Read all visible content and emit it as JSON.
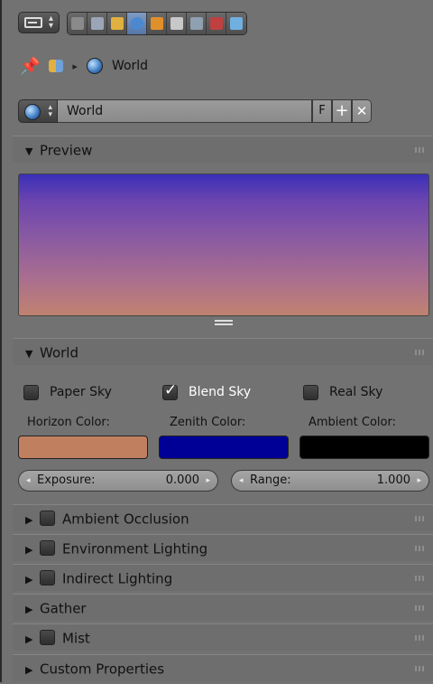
{
  "toolbar": {
    "tabs": [
      {
        "icon": "render-icon",
        "color": "#8a8a8a",
        "active": false
      },
      {
        "icon": "render-layers-icon",
        "color": "#9aa6b8",
        "active": false
      },
      {
        "icon": "scene-icon",
        "color": "#e0b040",
        "active": false
      },
      {
        "icon": "world-icon",
        "color": "#4b88d0",
        "active": true
      },
      {
        "icon": "object-icon",
        "color": "#e0902a",
        "active": false
      },
      {
        "icon": "constraints-icon",
        "color": "#c8c8c8",
        "active": false
      },
      {
        "icon": "modifiers-icon",
        "color": "#8fa0b0",
        "active": false
      },
      {
        "icon": "texture-icon",
        "color": "#c04040",
        "active": false
      },
      {
        "icon": "particles-icon",
        "color": "#70b0e0",
        "active": false
      }
    ]
  },
  "breadcrumb": {
    "label": "World"
  },
  "datablock": {
    "name": "World",
    "fake_user": "F",
    "add": "+",
    "remove": "✕"
  },
  "panels": {
    "preview": "Preview",
    "world": "World",
    "ambient_occlusion": "Ambient Occlusion",
    "environment_lighting": "Environment Lighting",
    "indirect_lighting": "Indirect Lighting",
    "gather": "Gather",
    "mist": "Mist",
    "custom_properties": "Custom Properties"
  },
  "world": {
    "paper_sky": {
      "label": "Paper Sky",
      "checked": false
    },
    "blend_sky": {
      "label": "Blend Sky",
      "checked": true
    },
    "real_sky": {
      "label": "Real Sky",
      "checked": false
    },
    "horizon_label": "Horizon Color:",
    "zenith_label": "Zenith Color:",
    "ambient_label": "Ambient Color:",
    "horizon_color": "#c08060",
    "zenith_color": "#000096",
    "ambient_color": "#000000",
    "exposure_label": "Exposure:",
    "exposure_value": "0.000",
    "range_label": "Range:",
    "range_value": "1.000"
  }
}
